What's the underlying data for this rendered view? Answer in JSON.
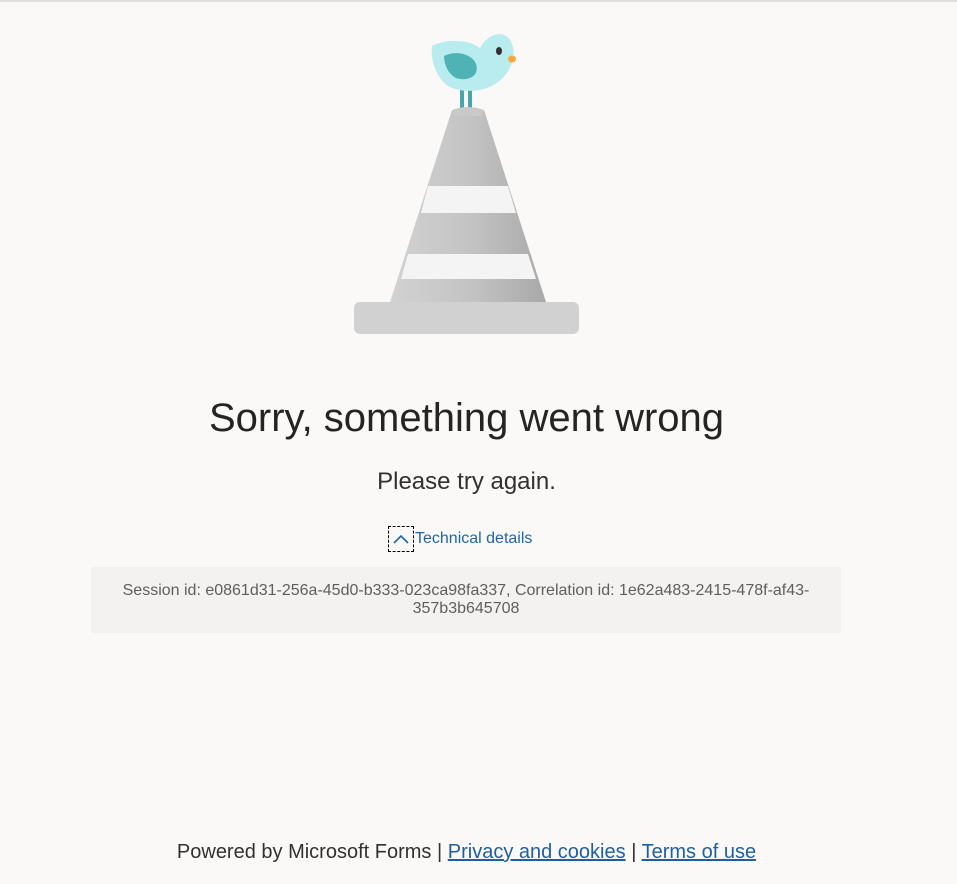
{
  "error": {
    "title": "Sorry, something went wrong",
    "subtitle": "Please try again.",
    "technical_details_label": "Technical details",
    "details_text": "Session id: e0861d31-256a-45d0-b333-023ca98fa337, Correlation id: 1e62a483-2415-478f-af43-357b3b645708"
  },
  "footer": {
    "powered_by": "Powered by Microsoft Forms",
    "separator": "|",
    "privacy_link": "Privacy and cookies",
    "terms_link": "Terms of use"
  },
  "colors": {
    "background": "#faf9f8",
    "link": "#1f66a8",
    "details_background": "#f3f2f1"
  },
  "icons": {
    "illustration": "bird-on-traffic-cone-illustration",
    "toggle": "chevron-up-icon"
  }
}
